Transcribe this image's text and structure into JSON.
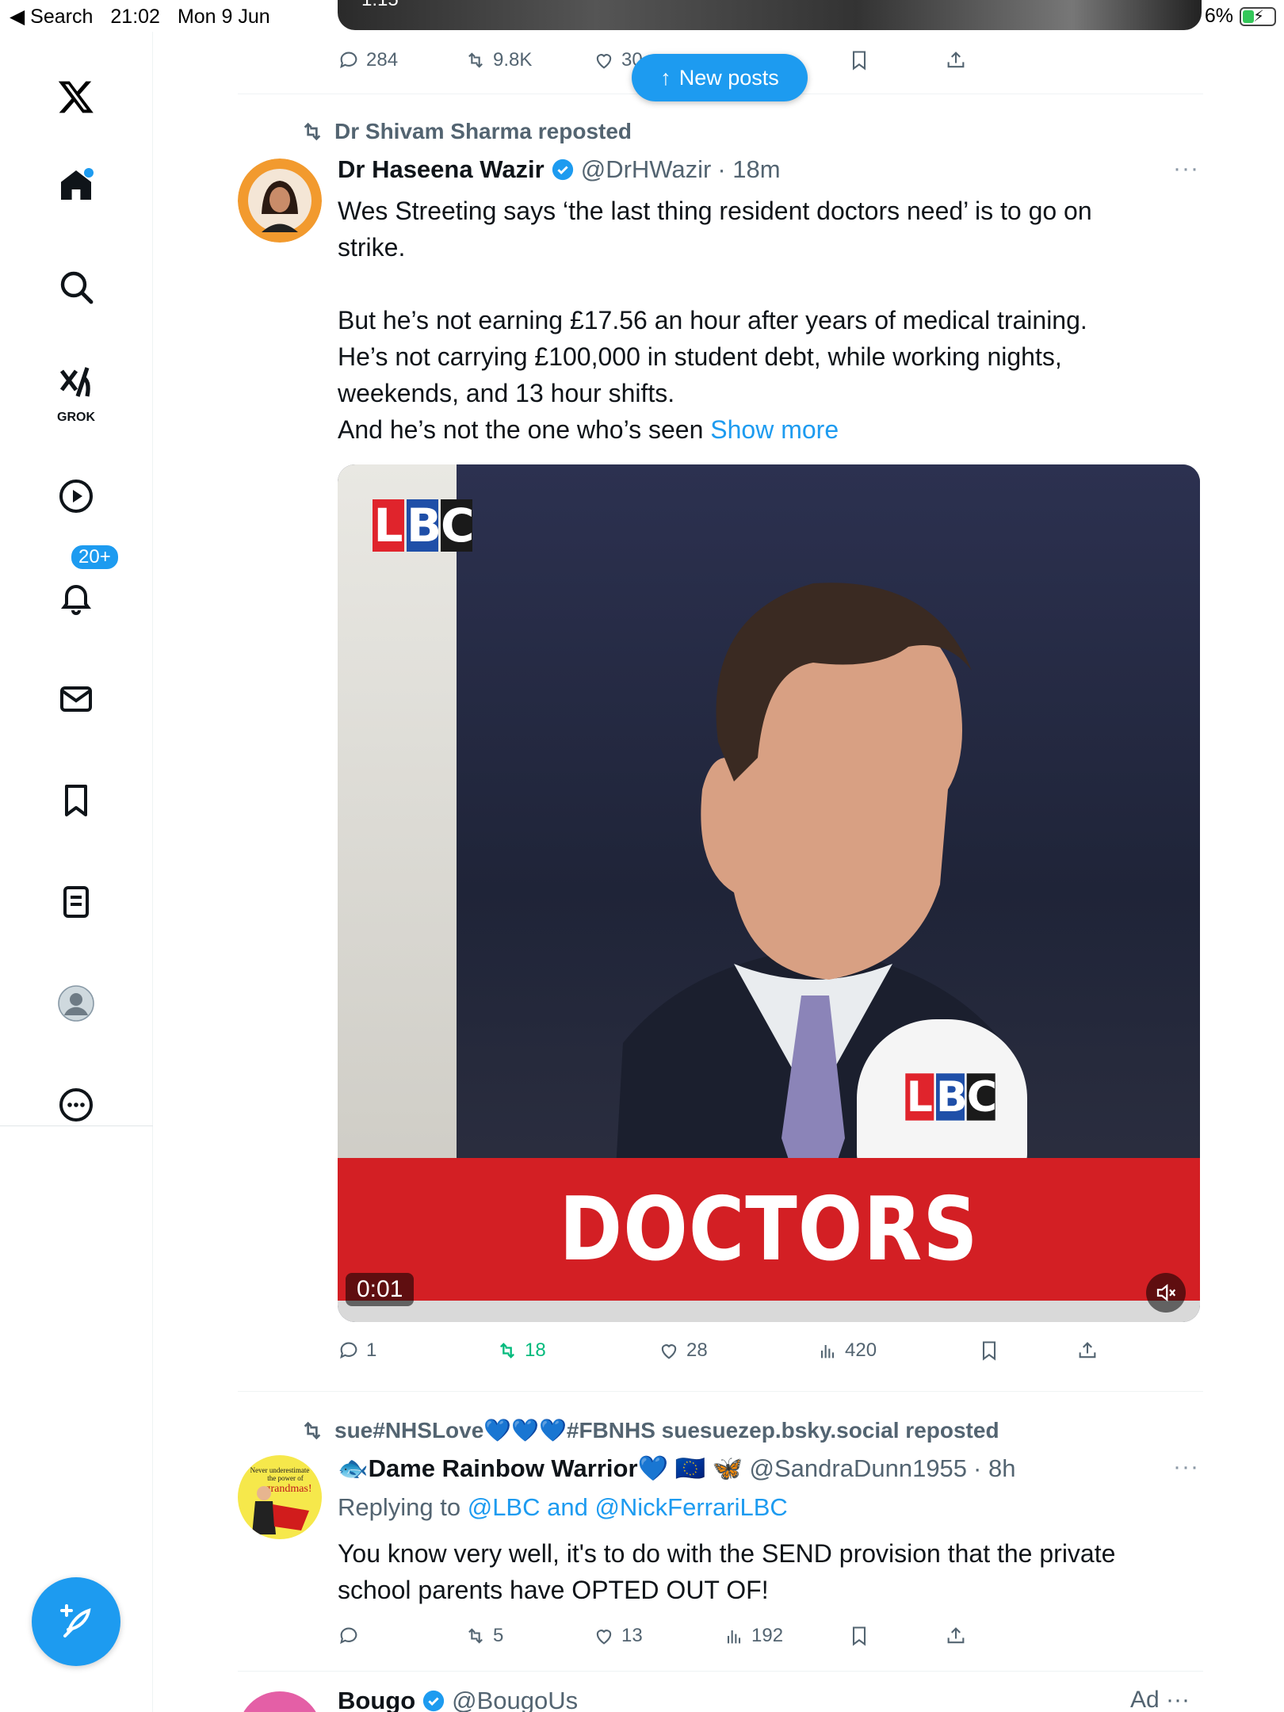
{
  "status_bar": {
    "back_label": "◀ Search",
    "time": "21:02",
    "date": "Mon 9 Jun",
    "battery": "6%"
  },
  "sidebar": {
    "notifications_badge": "20+",
    "grok_label": "GROK"
  },
  "top_post": {
    "media_time": "1:15",
    "replies": "284",
    "reposts": "9.8K",
    "likes": "30"
  },
  "new_posts_label": "New posts",
  "post1": {
    "reposted_by": "Dr Shivam Sharma reposted",
    "name": "Dr Haseena Wazir",
    "handle": "@DrHWazir",
    "time": "· 18m",
    "more": "···",
    "text_lines": [
      "Wes Streeting says ‘the last thing resident doctors need’ is to go on",
      "strike.",
      "",
      "But he’s not earning £17.56 an hour after years of medical training.",
      "He’s not carrying £100,000 in student debt, while working nights,",
      "weekends, and 13 hour shifts.",
      "And he’s not the one who’s seen "
    ],
    "show_more": "Show more",
    "video": {
      "banner": "DOCTORS",
      "logo_letters": [
        "L",
        "B",
        "C"
      ],
      "timecode": "0:01"
    },
    "replies": "1",
    "reposts": "18",
    "likes": "28",
    "views": "420",
    "repost_color": "#00ba7c"
  },
  "post2": {
    "reposted_by": "sue#NHSLove💙💙💙#FBNHS suesuezep.bsky.social reposted",
    "name": "🐟Dame Rainbow Warrior💙 🇪🇺 🦋",
    "handle": "@SandraDunn1955",
    "time": "· 8h",
    "more": "···",
    "replying_prefix": "Replying to ",
    "replying_to": "@LBC and @NickFerrariLBC",
    "avatar_text": [
      "Never underestimate",
      "the power of",
      "grandmas!"
    ],
    "text_lines": [
      "You know very well, it's to do with the SEND provision that the private",
      "school parents have OPTED OUT OF!"
    ],
    "replies": "",
    "reposts": "5",
    "likes": "13",
    "views": "192"
  },
  "post3": {
    "name": "Bougo",
    "handle": "@BougoUs",
    "ad_label": "Ad ···"
  },
  "colors": {
    "accent": "#1d9bf0",
    "text_secondary": "#536471",
    "banner_red": "#d31f24"
  }
}
